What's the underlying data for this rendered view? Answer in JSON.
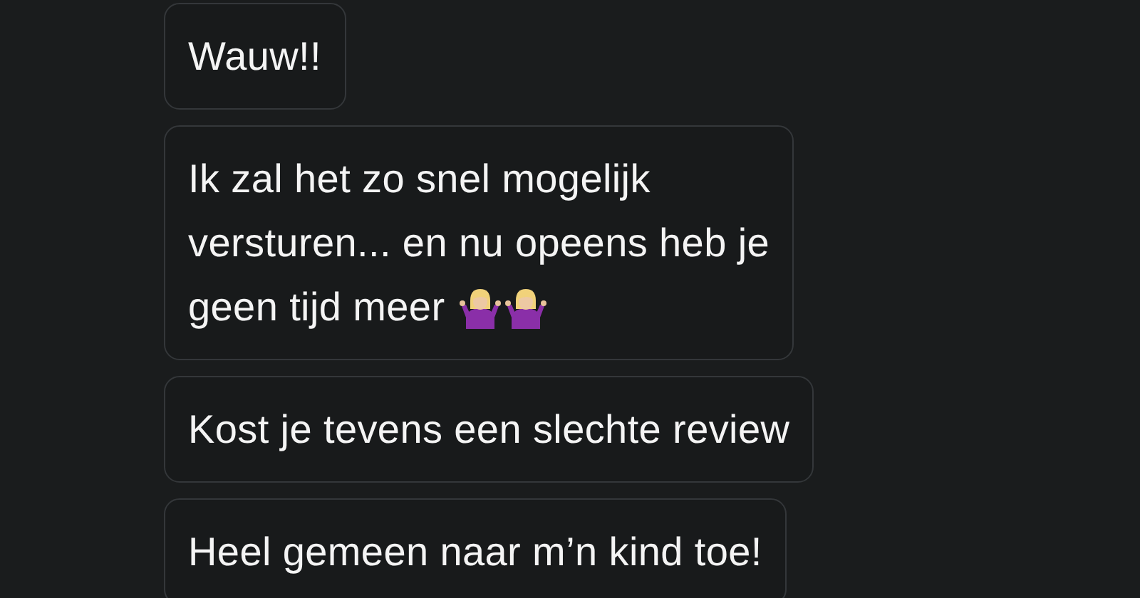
{
  "messages": [
    {
      "lines": [
        "Wauw!!"
      ]
    },
    {
      "lines": [
        "Ik zal het zo snel mogelijk",
        "versturen... en nu opeens heb je",
        "geen tijd meer"
      ],
      "icons": [
        {
          "kind": "shrug"
        },
        {
          "kind": "shrug"
        }
      ]
    },
    {
      "lines": [
        "Kost je tevens een slechte review"
      ]
    },
    {
      "lines": [
        "Heel gemeen naar m’n kind toe!"
      ]
    }
  ]
}
